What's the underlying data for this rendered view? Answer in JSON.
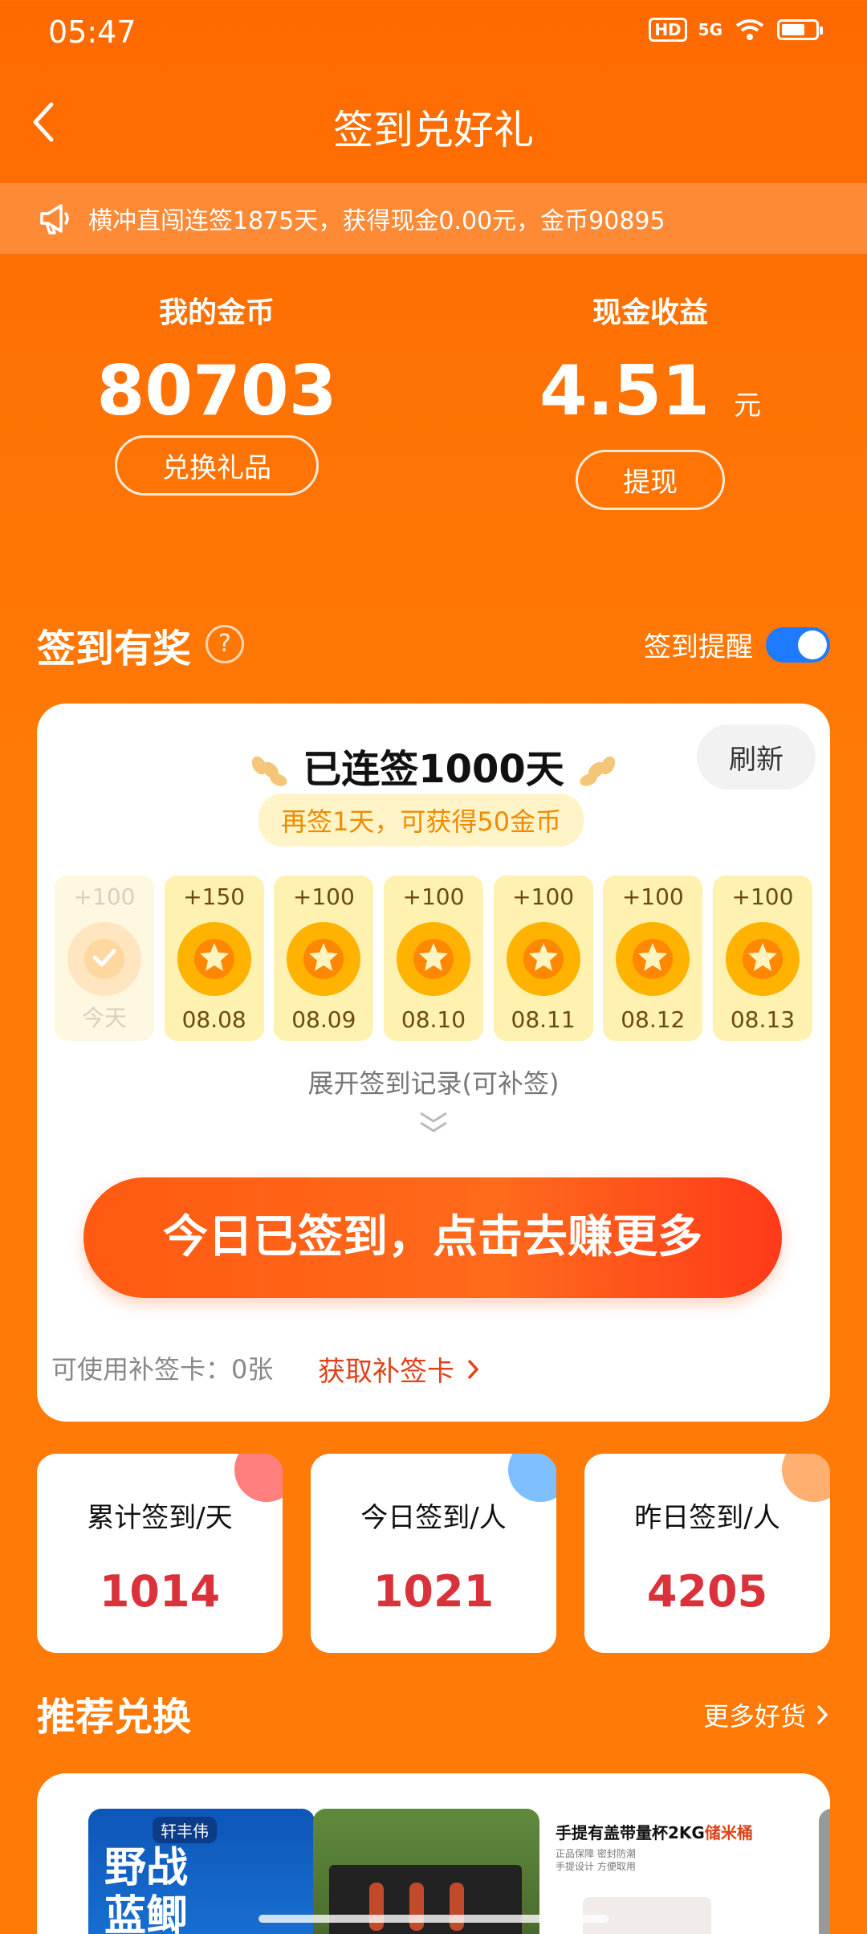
{
  "status": {
    "time": "05:47",
    "hd": "HD",
    "signal": "5G"
  },
  "nav": {
    "title": "签到兑好礼"
  },
  "notice": {
    "text": "横冲直闯连签1875天，获得现金0.00元，金币90895"
  },
  "wallet": {
    "coins_label": "我的金币",
    "coins_value": "80703",
    "coins_button": "兑换礼品",
    "cash_label": "现金收益",
    "cash_value": "4.51",
    "cash_unit": "元",
    "cash_button": "提现"
  },
  "checkin": {
    "section_title": "签到有奖",
    "help": "?",
    "reminder_label": "签到提醒",
    "reminder_on": true,
    "streak_text": "已连签1000天",
    "refresh": "刷新",
    "hint": "再签1天，可获得50金币",
    "days": [
      {
        "amount": "+100",
        "date": "今天",
        "done": true
      },
      {
        "amount": "+150",
        "date": "08.08",
        "done": false
      },
      {
        "amount": "+100",
        "date": "08.09",
        "done": false
      },
      {
        "amount": "+100",
        "date": "08.10",
        "done": false
      },
      {
        "amount": "+100",
        "date": "08.11",
        "done": false
      },
      {
        "amount": "+100",
        "date": "08.12",
        "done": false
      },
      {
        "amount": "+100",
        "date": "08.13",
        "done": false
      }
    ],
    "expand_text": "展开签到记录(可补签)",
    "main_button": "今日已签到，点击去赚更多",
    "makeup_cards": "可使用补签卡：0张",
    "get_card": "获取补签卡"
  },
  "stats": [
    {
      "label": "累计签到/天",
      "value": "1014",
      "color": "#ff7f7f"
    },
    {
      "label": "今日签到/人",
      "value": "1021",
      "color": "#7fbfff"
    },
    {
      "label": "昨日签到/人",
      "value": "4205",
      "color": "#ffaf6f"
    }
  ],
  "recommend": {
    "title": "推荐兑换",
    "more": "更多好货",
    "g1_brand": "轩丰伟",
    "g1_text": "野战\n蓝鲫",
    "g3_head_a": "手提有盖带量杯2KG",
    "g3_head_b": "储米桶",
    "g3_sub": "正品保障 密封防潮\n手提设计 方便取用"
  }
}
